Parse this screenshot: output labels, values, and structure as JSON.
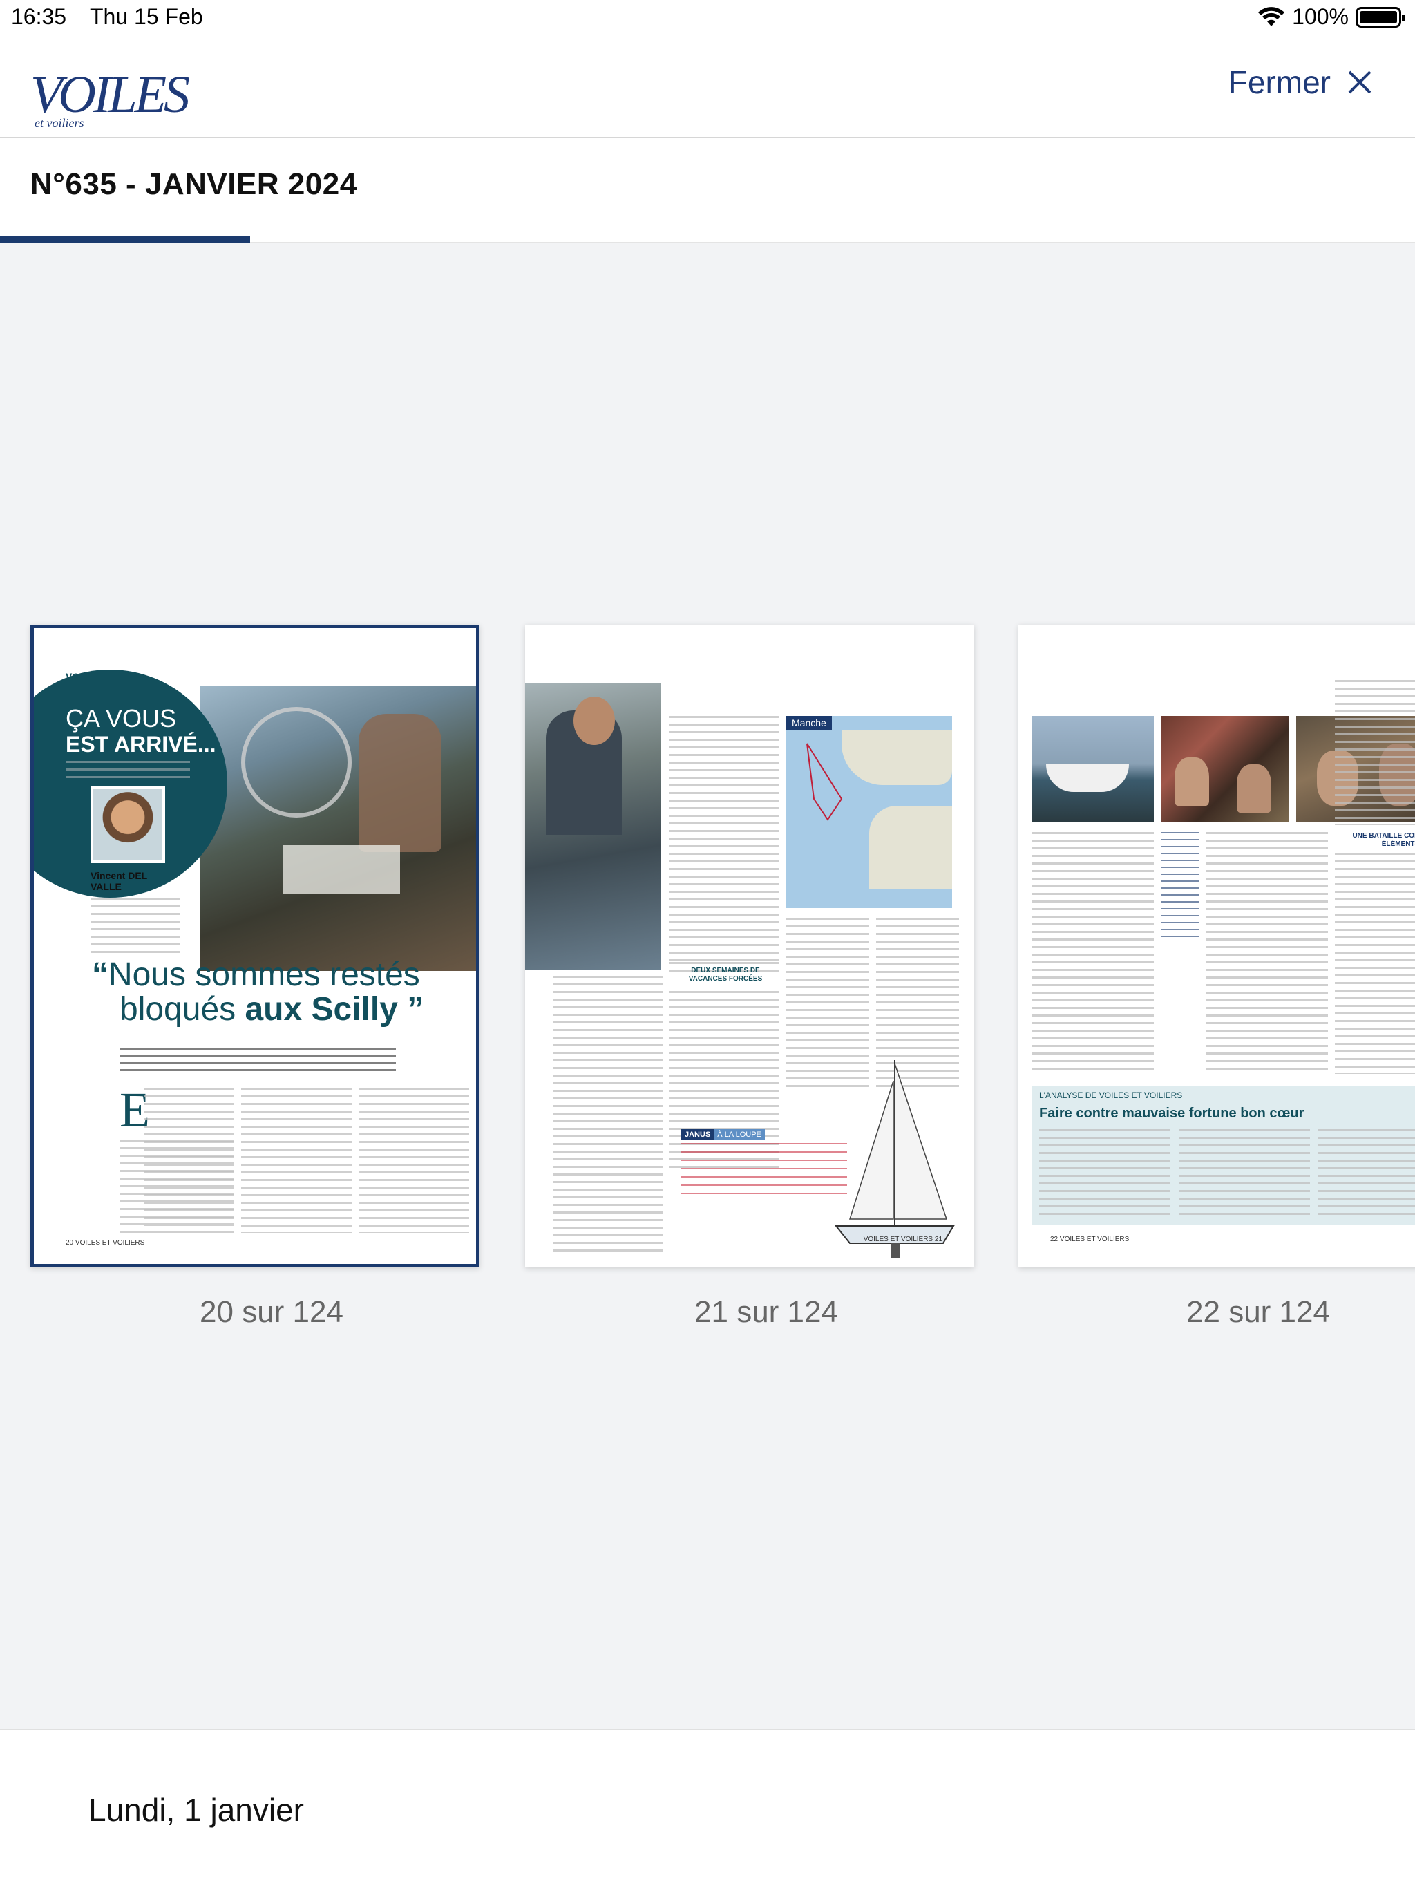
{
  "status_bar": {
    "time": "16:35",
    "date": "Thu 15 Feb",
    "battery": "100%"
  },
  "header": {
    "logo_text": "VOILES",
    "logo_sub": "et voiliers",
    "close_label": "Fermer"
  },
  "issue": {
    "title": "N°635 - JANVIER 2024",
    "progress_fraction": 0.177
  },
  "pages": [
    {
      "label": "20 sur 124",
      "section": "VOUS & VOILES",
      "badge_line1": "ÇA VOUS",
      "badge_line2": "EST ARRIVÉ...",
      "author": "Vincent DEL VALLE",
      "quote_line1": "Nous sommes restés",
      "quote_line2_a": "bloqués ",
      "quote_line2_b": "aux Scilly",
      "footer": "20   VOILES ET VOILIERS"
    },
    {
      "label": "21 sur 124",
      "map_label": "Manche",
      "subhead": "DEUX SEMAINES DE VACANCES FORCÉES",
      "box_tag_a": "JANUS",
      "box_tag_b": "À LA LOUPE",
      "footer": "VOILES ET VOILIERS   21"
    },
    {
      "label": "22 sur 124",
      "side_head": "UNE BATAILLE CONTRE LES ÉLÉMENTS",
      "analysis_tag": "L'ANALYSE DE VOILES ET VOILIERS",
      "analysis_title": "Faire contre mauvaise fortune bon cœur",
      "footer": "22   VOILES ET VOILIERS"
    }
  ],
  "footer": {
    "date_label": "Lundi, 1 janvier"
  },
  "colors": {
    "accent": "#1b3a6e",
    "teal": "#124f5c",
    "background": "#f2f3f5"
  }
}
